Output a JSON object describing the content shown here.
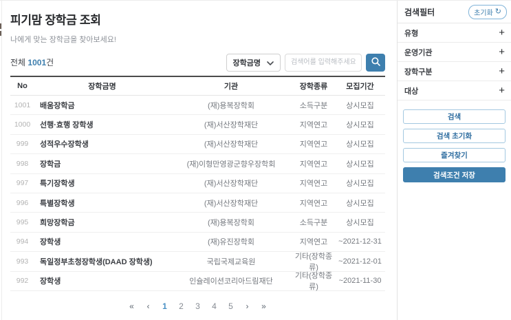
{
  "header": {
    "title": "피기맘 장학금 조회",
    "subtitle": "나에게 맞는 장학금을 찾아보세요!"
  },
  "toolbar": {
    "total_prefix": "전체 ",
    "total_count": "1001",
    "total_suffix": "건",
    "sort_selected": "장학금명",
    "sort_chevron_icon": "chevron-down",
    "search_placeholder": "검색어를 입력해주세요",
    "search_icon": "magnifier"
  },
  "table": {
    "columns": [
      "No",
      "장학금명",
      "기관",
      "장학종류",
      "모집기간"
    ],
    "rows": [
      {
        "no": "1001",
        "name": "배움장학금",
        "org": "(재)용복장학회",
        "type": "소득구분",
        "period": "상시모집"
      },
      {
        "no": "1000",
        "name": "선행·효행 장학생",
        "org": "(재)서산장학재단",
        "type": "지역연고",
        "period": "상시모집"
      },
      {
        "no": "999",
        "name": "성적우수장학생",
        "org": "(재)서산장학재단",
        "type": "지역연고",
        "period": "상시모집"
      },
      {
        "no": "998",
        "name": "장학금",
        "org": "(재)이형만영광군향우장학회",
        "type": "지역연고",
        "period": "상시모집"
      },
      {
        "no": "997",
        "name": "특기장학생",
        "org": "(재)서산장학재단",
        "type": "지역연고",
        "period": "상시모집"
      },
      {
        "no": "996",
        "name": "특별장학생",
        "org": "(재)서산장학재단",
        "type": "지역연고",
        "period": "상시모집"
      },
      {
        "no": "995",
        "name": "희망장학금",
        "org": "(재)용복장학회",
        "type": "소득구분",
        "period": "상시모집"
      },
      {
        "no": "994",
        "name": "장학생",
        "org": "(재)유진장학회",
        "type": "지역연고",
        "period": "~2021-12-31"
      },
      {
        "no": "993",
        "name": "독일정부초청장학생(DAAD 장학생)",
        "org": "국립국제교육원",
        "type": "기타(장학종류)",
        "period": "~2021-12-01"
      },
      {
        "no": "992",
        "name": "장학생",
        "org": "인슐레이션코리아드림재단",
        "type": "기타(장학종류)",
        "period": "~2021-11-30"
      }
    ]
  },
  "pagination": {
    "first": "«",
    "prev": "‹",
    "pages": [
      "1",
      "2",
      "3",
      "4",
      "5"
    ],
    "active_page": "1",
    "next": "›",
    "last": "»"
  },
  "filter_panel": {
    "title": "검색필터",
    "reset_label": "초기화",
    "reset_icon": "refresh",
    "reset_icon_glyph": "↻",
    "sections": [
      {
        "label": "유형",
        "expand_icon": "+"
      },
      {
        "label": "운영기관",
        "expand_icon": "+"
      },
      {
        "label": "장학구분",
        "expand_icon": "+"
      },
      {
        "label": "대상",
        "expand_icon": "+"
      }
    ],
    "actions": [
      {
        "label": "검색",
        "style": "outline"
      },
      {
        "label": "검색 초기화",
        "style": "outline"
      },
      {
        "label": "즐겨찾기",
        "style": "outline"
      },
      {
        "label": "검색조건 저장",
        "style": "filled"
      }
    ]
  },
  "colors": {
    "accent_blue": "#3e7fae",
    "outline_button_border": "#a3c8e0",
    "active_page_blue": "#4a90c4",
    "table_top_border": "#4a4a4a"
  }
}
